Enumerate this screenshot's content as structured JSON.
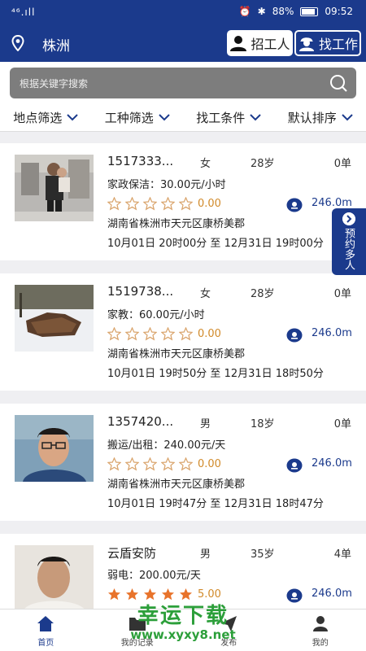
{
  "status_bar": {
    "signal_text": "⁴⁶.ıll",
    "battery_percent": "88%",
    "time": "09:52"
  },
  "header": {
    "city": "株洲",
    "recruit_label": "招工人",
    "find_job_label": "找工作"
  },
  "search": {
    "placeholder": "根据关键字搜索"
  },
  "filters": [
    {
      "label": "地点筛选"
    },
    {
      "label": "工种筛选"
    },
    {
      "label": "找工条件"
    },
    {
      "label": "默认排序"
    }
  ],
  "workers": [
    {
      "name": "1517333...",
      "gender": "女",
      "age": "28岁",
      "orders": "0单",
      "service": "家政保洁：30.00元/小时",
      "rating_value": 0,
      "rating_text": "0.00",
      "distance": "246.0m",
      "address": "湖南省株洲市天元区康桥美郡",
      "time_range": "10月01日 20时00分 至 12月31日 19时00分"
    },
    {
      "name": "1519738...",
      "gender": "女",
      "age": "28岁",
      "orders": "0单",
      "service": "家教：60.00元/小时",
      "rating_value": 0,
      "rating_text": "0.00",
      "distance": "246.0m",
      "address": "湖南省株洲市天元区康桥美郡",
      "time_range": "10月01日 19时50分 至 12月31日 18时50分"
    },
    {
      "name": "1357420...",
      "gender": "男",
      "age": "18岁",
      "orders": "0单",
      "service": "搬运/出租：240.00元/天",
      "rating_value": 0,
      "rating_text": "0.00",
      "distance": "246.0m",
      "address": "湖南省株洲市天元区康桥美郡",
      "time_range": "10月01日 19时47分 至 12月31日 18时47分"
    },
    {
      "name": "云盾安防",
      "gender": "男",
      "age": "35岁",
      "orders": "4单",
      "service": "弱电：200.00元/天",
      "rating_value": 5,
      "rating_text": "5.00",
      "distance": "246.0m",
      "address": "",
      "time_range": ""
    }
  ],
  "side_tab": {
    "label": "预约多人"
  },
  "tabbar": [
    {
      "label": "首页",
      "active": true
    },
    {
      "label": "我的记录",
      "active": false
    },
    {
      "label": "发布",
      "active": false
    },
    {
      "label": "我的",
      "active": false
    }
  ],
  "watermark": {
    "text": "幸运下载",
    "url": "www.xyxy8.net"
  },
  "colors": {
    "brand": "#1b3a8c",
    "star_filled": "#e8732b",
    "star_empty": "#d9a36a",
    "rating_text": "#d18a2a",
    "watermark": "#2c9f3a"
  }
}
